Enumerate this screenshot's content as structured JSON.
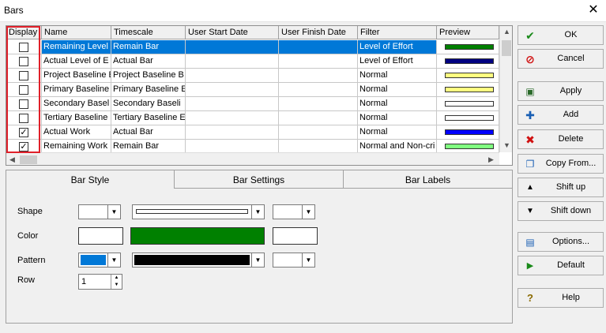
{
  "window": {
    "title": "Bars",
    "close_glyph": "✕"
  },
  "grid": {
    "columns": [
      "Display",
      "Name",
      "Timescale",
      "User Start Date",
      "User Finish Date",
      "Filter",
      "Preview"
    ],
    "rows": [
      {
        "checked": false,
        "name": "Remaining Level of",
        "timescale": "Remain Bar",
        "start": "",
        "finish": "",
        "filter": "Level of Effort",
        "preview_color": "#008000"
      },
      {
        "checked": false,
        "name": "Actual Level of E",
        "timescale": "Actual Bar",
        "start": "",
        "finish": "",
        "filter": "Level of Effort",
        "preview_color": "#000080"
      },
      {
        "checked": false,
        "name": "Project Baseline E",
        "timescale": "Project Baseline B",
        "start": "",
        "finish": "",
        "filter": "Normal",
        "preview_color": "#ffff80"
      },
      {
        "checked": false,
        "name": "Primary Baseline",
        "timescale": "Primary Baseline E",
        "start": "",
        "finish": "",
        "filter": "Normal",
        "preview_color": "#ffff80"
      },
      {
        "checked": false,
        "name": "Secondary Basel",
        "timescale": "Secondary Baseli",
        "start": "",
        "finish": "",
        "filter": "Normal",
        "preview_color": "#ffffff"
      },
      {
        "checked": false,
        "name": "Tertiary Baseline",
        "timescale": "Tertiary Baseline E",
        "start": "",
        "finish": "",
        "filter": "Normal",
        "preview_color": "#ffffff"
      },
      {
        "checked": true,
        "name": "Actual Work",
        "timescale": "Actual Bar",
        "start": "",
        "finish": "",
        "filter": "Normal",
        "preview_color": "#0000ff"
      },
      {
        "checked": true,
        "name": "Remaining Work",
        "timescale": "Remain Bar",
        "start": "",
        "finish": "",
        "filter": "Normal and Non-cri",
        "preview_color": "#80ff80"
      }
    ]
  },
  "tabs": [
    "Bar Style",
    "Bar Settings",
    "Bar Labels"
  ],
  "bar_style": {
    "shape_label": "Shape",
    "color_label": "Color",
    "pattern_label": "Pattern",
    "row_label": "Row",
    "row_value": "1",
    "color_value": "#008000",
    "pattern_color": "#0078d7"
  },
  "buttons": {
    "ok": "OK",
    "cancel": "Cancel",
    "apply": "Apply",
    "add": "Add",
    "delete": "Delete",
    "copy_from": "Copy From...",
    "shift_up": "Shift up",
    "shift_down": "Shift down",
    "options": "Options...",
    "default": "Default",
    "help": "Help"
  }
}
